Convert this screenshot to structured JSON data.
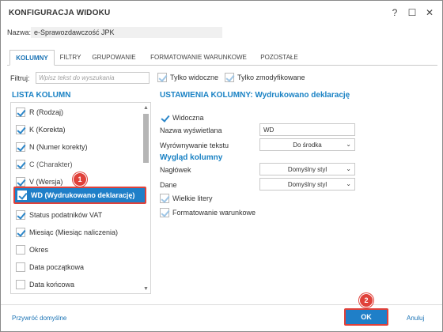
{
  "window": {
    "title": "KONFIGURACJA WIDOKU",
    "help_symbol": "?",
    "maximize_symbol": "☐",
    "close_symbol": "✕"
  },
  "name_row": {
    "label": "Nazwa:",
    "value": "e-Sprawozdawczość JPK"
  },
  "tabs": [
    {
      "label": "KOLUMNY",
      "active": true
    },
    {
      "label": "FILTRY",
      "active": false
    },
    {
      "label": "GRUPOWANIE",
      "active": false
    },
    {
      "label": "FORMATOWANIE WARUNKOWE",
      "active": false
    },
    {
      "label": "POZOSTAŁE",
      "active": false
    }
  ],
  "filter": {
    "label": "Filtruj:",
    "placeholder": "Wpisz tekst do wyszukania",
    "only_visible_label": "Tylko widoczne",
    "only_modified_label": "Tylko zmodyfikowane",
    "only_visible_checked": true,
    "only_modified_checked": true
  },
  "column_list": {
    "header": "LISTA KOLUMN",
    "items": [
      {
        "label": "R (Rodzaj)",
        "checked": true
      },
      {
        "label": "K (Korekta)",
        "checked": true
      },
      {
        "label": "N (Numer korekty)",
        "checked": true
      },
      {
        "label": "C (Charakter)",
        "checked": true
      },
      {
        "label": "V (Wersja)",
        "checked": true
      },
      {
        "label": "WD (Wydrukowano deklarację)",
        "checked": true,
        "selected": true
      },
      {
        "label": "Status podatników VAT",
        "checked": true
      },
      {
        "label": "Miesiąc (Miesiąc naliczenia)",
        "checked": true
      },
      {
        "label": "Okres",
        "checked": false
      },
      {
        "label": "Data początkowa",
        "checked": false
      },
      {
        "label": "Data końcowa",
        "checked": false
      }
    ],
    "scroll_up": "▲",
    "scroll_down": "▼"
  },
  "badges": {
    "first": "1",
    "second": "2"
  },
  "settings": {
    "header": "USTAWIENIA KOLUMNY: Wydrukowano deklarację",
    "visible_label": "Widoczna",
    "visible_checked": true,
    "display_name_label": "Nazwa wyświetlana",
    "display_name_value": "WD",
    "alignment_label": "Wyrównywanie tekstu",
    "alignment_value": "Do środka",
    "look_header": "Wygląd kolumny",
    "header_label": "Nagłówek",
    "header_value": "Domyślny styl",
    "data_label": "Dane",
    "data_value": "Domyślny styl",
    "uppercase_label": "Wielkie litery",
    "uppercase_checked": false,
    "conditional_label": "Formatowanie warunkowe",
    "conditional_checked": false,
    "caret": "⌄"
  },
  "footer": {
    "restore_label": "Przywróć domyślne",
    "ok_label": "OK",
    "cancel_label": "Anuluj"
  },
  "colors": {
    "accent": "#1f7fc8",
    "highlight": "#e0413a",
    "heading": "#1a82c4"
  }
}
